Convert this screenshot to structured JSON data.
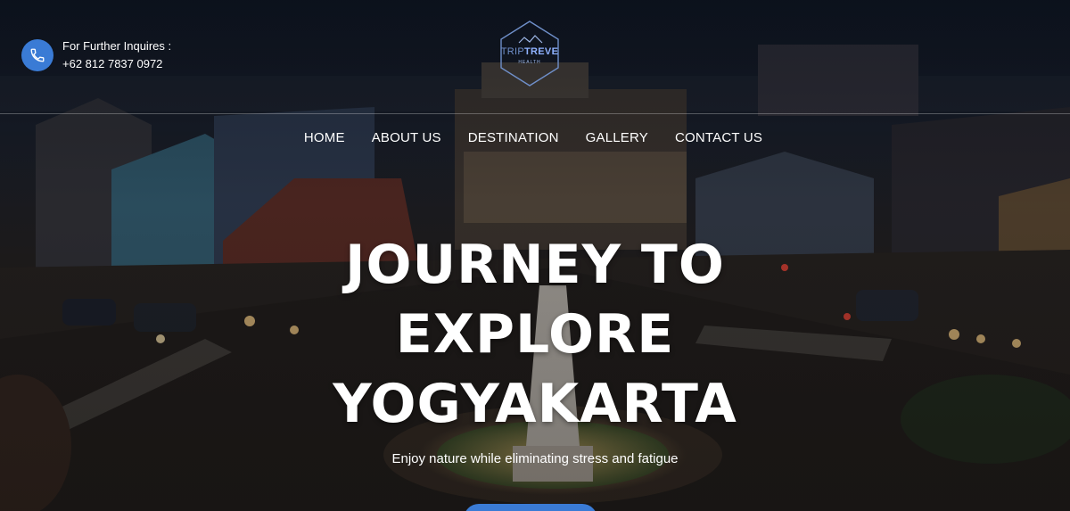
{
  "contact": {
    "label": "For Further Inquires :",
    "phone": "+62 812 7837 0972",
    "icon": "phone-icon",
    "accent": "#3a7bd5"
  },
  "logo": {
    "part1": "TRIP",
    "part2": "TREVE",
    "sub": "HEALTH"
  },
  "nav": {
    "items": [
      "HOME",
      "ABOUT US",
      "DESTINATION",
      "GALLERY",
      "CONTACT US"
    ]
  },
  "hero": {
    "line1": "JOURNEY TO",
    "line2": "EXPLORE",
    "line3": "YOGYAKARTA",
    "subtitle": "Enjoy nature while eliminating stress and fatigue"
  }
}
